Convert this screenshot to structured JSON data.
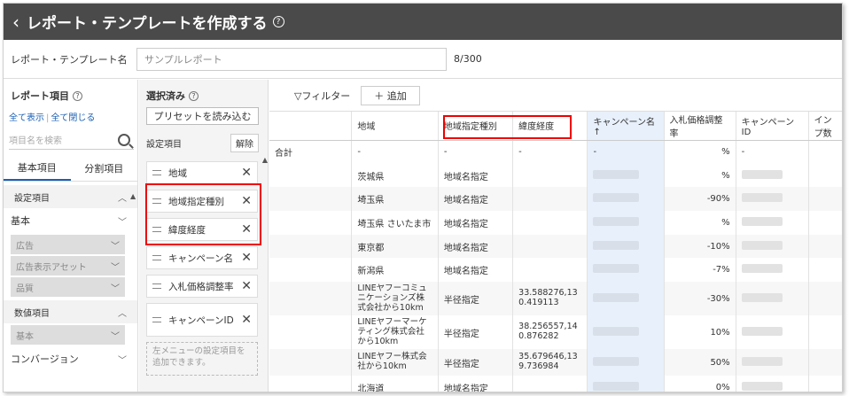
{
  "header": {
    "back_icon": "‹",
    "title": "レポート・テンプレートを作成する",
    "help": "?"
  },
  "name_bar": {
    "label": "レポート・テンプレート名",
    "value": "サンプルレポート",
    "count": "8/300"
  },
  "left_panel": {
    "title": "レポート項目",
    "show_all": "全て表示",
    "close_all": "全て閉じる",
    "search_placeholder": "項目名を検索",
    "tabs": [
      "基本項目",
      "分割項目"
    ],
    "sections": [
      {
        "label": "設定項目",
        "rows": [
          {
            "label": "基本",
            "disabled": false
          },
          {
            "label": "広告",
            "disabled": true
          },
          {
            "label": "広告表示アセット",
            "disabled": true
          },
          {
            "label": "品質",
            "disabled": true
          }
        ]
      },
      {
        "label": "数値項目",
        "rows": [
          {
            "label": "基本",
            "disabled": true
          },
          {
            "label": "コンバージョン",
            "disabled": false
          }
        ]
      }
    ]
  },
  "selected_panel": {
    "title": "選択済み",
    "preset_button": "プリセットを読み込む",
    "sub_title": "設定項目",
    "clear_button": "解除",
    "chips": [
      "地域",
      "地域指定種別",
      "緯度経度",
      "キャンペーン名",
      "入札価格調整率",
      "キャンペーンID"
    ],
    "drop_hint": "左メニューの設定項目を追加できます。"
  },
  "table": {
    "filter_label": "フィルター",
    "add_label": "追加",
    "columns": [
      "地域",
      "地域指定種別",
      "緯度経度",
      "キャンペーン名",
      "入札価格調整率",
      "キャンペーンID",
      "インプ数"
    ],
    "total_label": "合計",
    "total_row": [
      "-",
      "-",
      "-",
      "-",
      "%",
      "-"
    ],
    "rows": [
      [
        "茨城県",
        "地域名指定",
        "",
        "%"
      ],
      [
        "埼玉県",
        "地域名指定",
        "",
        "-90%"
      ],
      [
        "埼玉県 さいたま市",
        "地域名指定",
        "",
        "%"
      ],
      [
        "東京都",
        "地域名指定",
        "",
        "-10%"
      ],
      [
        "新潟県",
        "地域名指定",
        "",
        "-7%"
      ],
      [
        "LINEヤフーコミュニケーションズ株式会社から10km",
        "半径指定",
        "33.588276,130.419113",
        "-30%"
      ],
      [
        "LINEヤフーマーケティング株式会社から10km",
        "半径指定",
        "38.256557,140.876282",
        "10%"
      ],
      [
        "LINEヤフー株式会社から10km",
        "半径指定",
        "35.679646,139.736984",
        "50%"
      ],
      [
        "北海道",
        "地域名指定",
        "",
        "0%"
      ]
    ]
  }
}
